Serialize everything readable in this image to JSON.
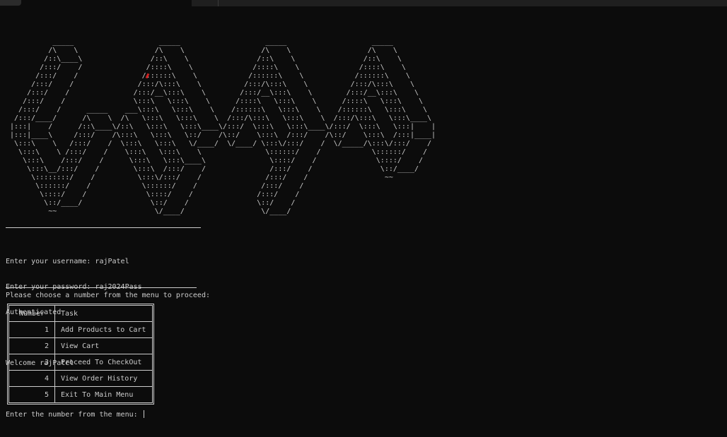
{
  "banner_art": "           _____                    _____                    _____                    _____\n          /\\    \\                  /\\    \\                  /\\    \\                  /\\    \\\n         /::\\____\\                /::\\    \\                /::\\    \\                /::\\    \\\n        /:::/    /               /::::\\    \\              /::::\\    \\              /::::\\    \\\n       /:::/    /               /::::::\\    \\            /::::::\\    \\            /::::::\\    \\\n      /:::/    /               /:::/\\:::\\    \\          /:::/\\:::\\    \\          /:::/\\:::\\    \\\n     /:::/    /               /:::/__\\:::\\    \\        /:::/__\\:::\\    \\        /:::/__\\:::\\    \\\n    /:::/    /                \\:::\\   \\:::\\    \\      /::::\\   \\:::\\    \\      /::::\\   \\:::\\    \\\n   /:::/    /      _____    ___\\:::\\   \\:::\\    \\    /::::::\\   \\:::\\    \\    /::::::\\   \\:::\\    \\\n  /:::/____/      /\\    \\  /\\   \\:::\\   \\:::\\    \\  /:::/\\:::\\   \\:::\\    \\  /:::/\\:::\\   \\:::\\____\\\n |:::|    /      /::\\____\\/::\\   \\:::\\   \\:::\\____\\/:::/  \\:::\\   \\:::\\____\\/:::/  \\:::\\   \\:::|    |\n |:::|____\\     /:::/    /\\:::\\   \\:::\\   \\::/    /\\::/    \\:::\\  /:::/    /\\::/    \\:::\\  /:::|____|\n  \\:::\\    \\   /:::/    /  \\:::\\   \\:::\\   \\/____/  \\/____/ \\:::\\/:::/    /  \\/_____/\\:::\\/:::/    /\n   \\:::\\    \\ /:::/    /    \\:::\\   \\:::\\    \\               \\::::::/    /            \\::::::/    /\n    \\:::\\    /:::/    /      \\:::\\   \\:::\\____\\               \\::::/    /              \\::::/    /\n     \\:::\\__/:::/    /        \\:::\\  /:::/    /               /:::/    /                \\::/____/\n      \\::::::::/    /          \\:::\\/:::/    /               /:::/    /                  ~~\n       \\::::::/    /            \\::::::/    /               /:::/    /\n        \\::::/    /              \\::::/    /               /:::/    /\n         \\::/____/                \\::/    /                \\::/    /\n          ~~                       \\/____/                  \\/____/",
  "prompts": {
    "username_line": "Enter your username: rajPatel",
    "password_line": "Enter your password: raj2024Pass",
    "auth_status": "Authenticated",
    "welcome": "Welcome rajPatel",
    "choose": "Please choose a number from the menu to proceed:",
    "final_prompt": "Enter the number from the menu: "
  },
  "menu": {
    "headers": {
      "number": "Number",
      "task": "Task"
    },
    "rows": [
      {
        "number": "1",
        "task": "Add Products to Cart"
      },
      {
        "number": "2",
        "task": "View Cart"
      },
      {
        "number": "3",
        "task": "Proceed To CheckOut"
      },
      {
        "number": "4",
        "task": "View Order History"
      },
      {
        "number": "5",
        "task": "Exit To Main Menu"
      }
    ]
  },
  "colors": {
    "background": "#0c0c0c",
    "foreground": "#cccccc",
    "accent_mark": "#d02020"
  }
}
